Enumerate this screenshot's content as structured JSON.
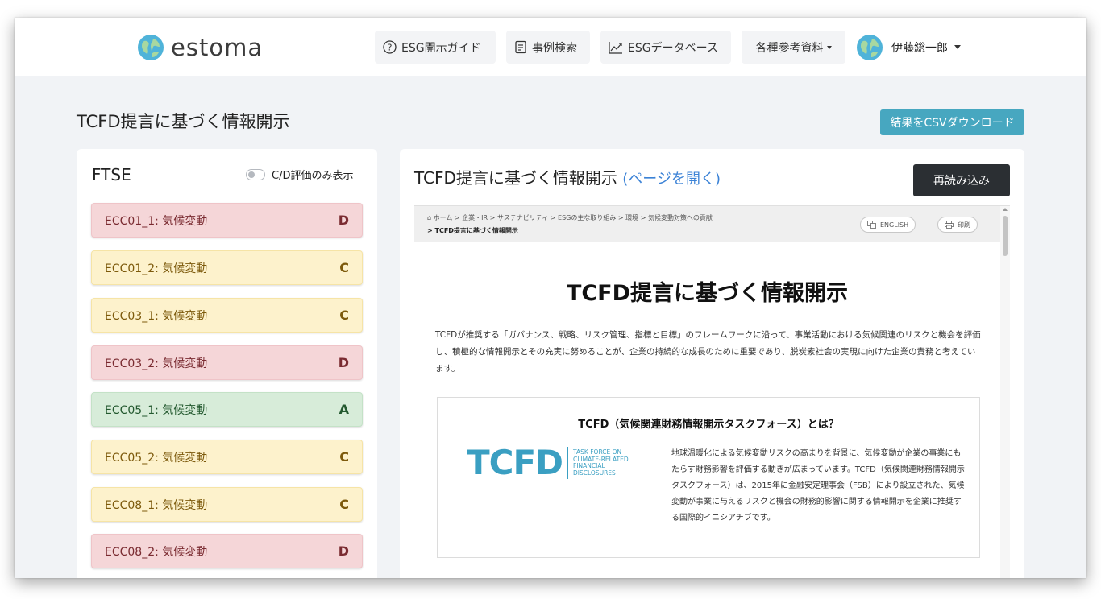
{
  "header": {
    "logo_text": "estoma",
    "nav": [
      {
        "label": "ESG開示ガイド",
        "icon": "help-circle-icon"
      },
      {
        "label": "事例検索",
        "icon": "document-list-icon"
      },
      {
        "label": "ESGデータベース",
        "icon": "chart-line-icon"
      },
      {
        "label": "各種参考資料",
        "icon": "chevron-down-icon"
      }
    ],
    "user_name": "伊藤総一郎"
  },
  "page": {
    "title": "TCFD提言に基づく情報開示",
    "csv_button": "結果をCSVダウンロード"
  },
  "left": {
    "heading": "FTSE",
    "toggle_label": "C/D評価のみ表示",
    "items": [
      {
        "label": "ECC01_1: 気候変動",
        "grade": "D"
      },
      {
        "label": "ECC01_2: 気候変動",
        "grade": "C"
      },
      {
        "label": "ECC03_1: 気候変動",
        "grade": "C"
      },
      {
        "label": "ECC03_2: 気候変動",
        "grade": "D"
      },
      {
        "label": "ECC05_1: 気候変動",
        "grade": "A"
      },
      {
        "label": "ECC05_2: 気候変動",
        "grade": "C"
      },
      {
        "label": "ECC08_1: 気候変動",
        "grade": "C"
      },
      {
        "label": "ECC08_2: 気候変動",
        "grade": "D"
      }
    ]
  },
  "right": {
    "title": "TCFD提言に基づく情報開示",
    "open_link": "(ページを開く)",
    "reload_button": "再読み込み",
    "embed": {
      "breadcrumb_line1": "ホーム > 企業・IR > サステナビリティ > ESGの主な取り組み > 環境 > 気候変動対策への貢献",
      "breadcrumb_line2": "> TCFD提言に基づく情報開示",
      "english_label": "ENGLISH",
      "print_label": "印刷",
      "heading": "TCFD提言に基づく情報開示",
      "intro": "TCFDが推奨する「ガバナンス、戦略、リスク管理、指標と目標」のフレームワークに沿って、事業活動における気候関連のリスクと機会を評価し、積極的な情報開示とその充実に努めることが、企業の持続的な成長のために重要であり、脱炭素社会の実現に向けた企業の責務と考えています。",
      "box_title": "TCFD（気候関連財務情報開示タスクフォース）とは？",
      "logo_letters": "TCFD",
      "logo_sub": [
        "TASK FORCE ON",
        "CLIMATE-RELATED",
        "FINANCIAL",
        "DISCLOSURES"
      ],
      "box_text": "地球温暖化による気候変動リスクの高まりを背景に、気候変動が企業の事業にもたらす財務影響を評価する動きが広まっています。TCFD（気候関連財務情報開示タスクフォース）は、2015年に金融安定理事会（FSB）により設立された、気候変動が事業に与えるリスクと機会の財務的影響に関する情報開示を企業に推奨する国際的イニシアチブです。"
    }
  },
  "colors": {
    "accent": "#47a7c0",
    "grade_d": "#f5d6d8",
    "grade_c": "#fdf2cc",
    "grade_a": "#d7ecd9",
    "link": "#3b82d6",
    "tcfd_blue": "#3a9fc2"
  }
}
